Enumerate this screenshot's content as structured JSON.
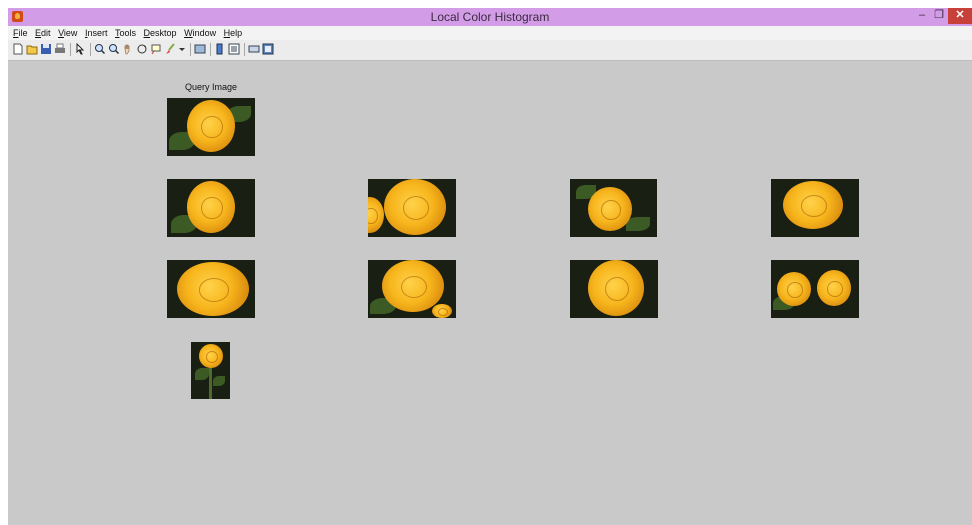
{
  "window": {
    "title": "Local Color Histogram",
    "controls": {
      "minimize": "–",
      "maximize": "❐",
      "close": "✕"
    }
  },
  "menu": [
    "File",
    "Edit",
    "View",
    "Insert",
    "Tools",
    "Desktop",
    "Window",
    "Help"
  ],
  "toolbar": {
    "icons": [
      "new-figure-icon",
      "open-file-icon",
      "save-icon",
      "print-icon",
      "edit-plot-arrow-icon",
      "zoom-in-icon",
      "zoom-out-icon",
      "pan-icon",
      "rotate-3d-icon",
      "data-cursor-icon",
      "brush-icon",
      "link-plot-icon",
      "insert-colorbar-icon",
      "insert-legend-icon",
      "hide-plot-tools-icon",
      "show-plot-tools-icon"
    ]
  },
  "figure": {
    "query_label": "Query Image",
    "background": "#c9c9c9",
    "rose_color": "#f7b51c"
  }
}
